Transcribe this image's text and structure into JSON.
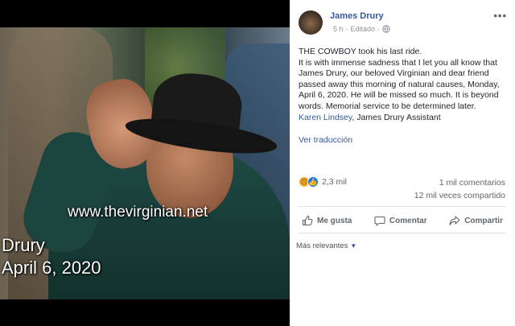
{
  "photo": {
    "watermark": "www.thevirginian.net",
    "caption_name": "Drury",
    "caption_date": "April 6, 2020"
  },
  "post": {
    "author": "James Drury",
    "time": "5 h",
    "separator": "·",
    "edited": "Editado",
    "more": "•••",
    "text_lines": [
      "THE COWBOY took his last ride.",
      "It is with immense sadness that I let you all know that James Drury, our beloved Virginian and dear friend passed away this morning of natural causes, Monday, April 6, 2020. He will be missed so much. It is beyond words. Memorial service to be determined later."
    ],
    "signature_link": "Karen Lindsey",
    "signature_rest": ", James Drury Assistant",
    "translate": "Ver traducción",
    "reaction_count": "2,3 mil",
    "comments": "1 mil comentarios",
    "shares": "12 mil veces compartido",
    "actions": {
      "like": "Me gusta",
      "comment": "Comentar",
      "share": "Compartir"
    },
    "relevance": "Más relevantes",
    "accent_color": "#365899",
    "like_color": "#1877f2",
    "sad_color": "#f7b125"
  }
}
